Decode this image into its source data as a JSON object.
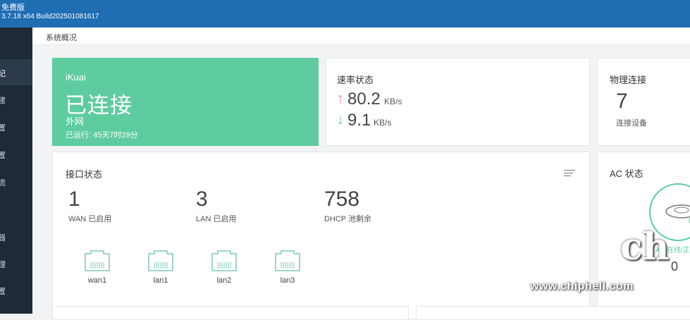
{
  "topbar": {
    "edition": "免费版",
    "build": "3.7.18 x64 Build202501081617"
  },
  "sidebar": {
    "items": [
      {
        "label": "纪",
        "active": true
      },
      {
        "label": "建"
      },
      {
        "label": "置"
      },
      {
        "label": "置"
      },
      {
        "label": "流"
      },
      {
        "label": "器"
      },
      {
        "label": "理"
      },
      {
        "label": "置"
      }
    ]
  },
  "breadcrumb": "系统概况",
  "wan": {
    "brand": "iKuai",
    "status": "已连接",
    "network": "外网",
    "uptime": "已运行: 45天7时29分"
  },
  "rate": {
    "title": "速率状态",
    "up": {
      "arrow": "↑",
      "value": "80.2",
      "unit": "KB/s"
    },
    "down": {
      "arrow": "↓",
      "value": "9.1",
      "unit": "KB/s"
    }
  },
  "physical": {
    "title": "物理连接",
    "count": "7",
    "label": "连接设备"
  },
  "interfaces": {
    "title": "接口状态",
    "stats": [
      {
        "value": "1",
        "label": "WAN 已启用"
      },
      {
        "value": "3",
        "label": "LAN 已启用"
      },
      {
        "value": "758",
        "label": "DHCP 池剩余"
      }
    ],
    "ports": [
      "wan1",
      "lan1",
      "lan2",
      "lan3"
    ]
  },
  "ac": {
    "title": "AC 状态",
    "text": "AP 在线/正常",
    "count": "0"
  },
  "watermark": {
    "url": "www.chiphell.com",
    "logo": "chip hell"
  },
  "colors": {
    "topbar": "#1f6db3",
    "sidebar": "#1f2a37",
    "accent": "#5ecc9f",
    "up": "#e98a8a"
  }
}
